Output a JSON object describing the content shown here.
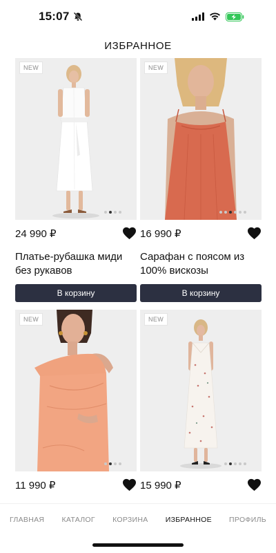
{
  "status_bar": {
    "time": "15:07",
    "silent_icon": "bell-slash-icon",
    "signal_icon": "signal-bars-icon",
    "wifi_icon": "wifi-icon",
    "battery_icon": "battery-charging-icon",
    "battery_color": "#34c759"
  },
  "header": {
    "title": "ИЗБРАННОЕ"
  },
  "products": [
    {
      "badge": "NEW",
      "price": "24 990 ₽",
      "title": "Платье-рубашка миди без рукавов",
      "cart_label": "В корзину",
      "image_desc": "white sleeveless shirt dress",
      "dot_count": 4,
      "active_dot": 1
    },
    {
      "badge": "NEW",
      "price": "16 990 ₽",
      "title": "Сарафан с поясом из 100% вискозы",
      "cart_label": "В корзину",
      "image_desc": "coral viscose slip dress",
      "dot_count": 6,
      "active_dot": 2
    },
    {
      "badge": "NEW",
      "price": "11 990 ₽",
      "title": "",
      "cart_label": "",
      "image_desc": "peach one-shoulder dress",
      "dot_count": 4,
      "active_dot": 1
    },
    {
      "badge": "NEW",
      "price": "15 990 ₽",
      "title": "",
      "cart_label": "",
      "image_desc": "white floral slip dress",
      "dot_count": 5,
      "active_dot": 1
    }
  ],
  "colors": {
    "button_bg": "#2c3041",
    "heart": "#111111",
    "image_bg": "#eeeeee"
  },
  "tabs": [
    {
      "label": "ГЛАВНАЯ",
      "active": false
    },
    {
      "label": "КАТАЛОГ",
      "active": false
    },
    {
      "label": "КОРЗИНА",
      "active": false
    },
    {
      "label": "ИЗБРАННОЕ",
      "active": true
    },
    {
      "label": "ПРОФИЛЬ",
      "active": false
    }
  ]
}
